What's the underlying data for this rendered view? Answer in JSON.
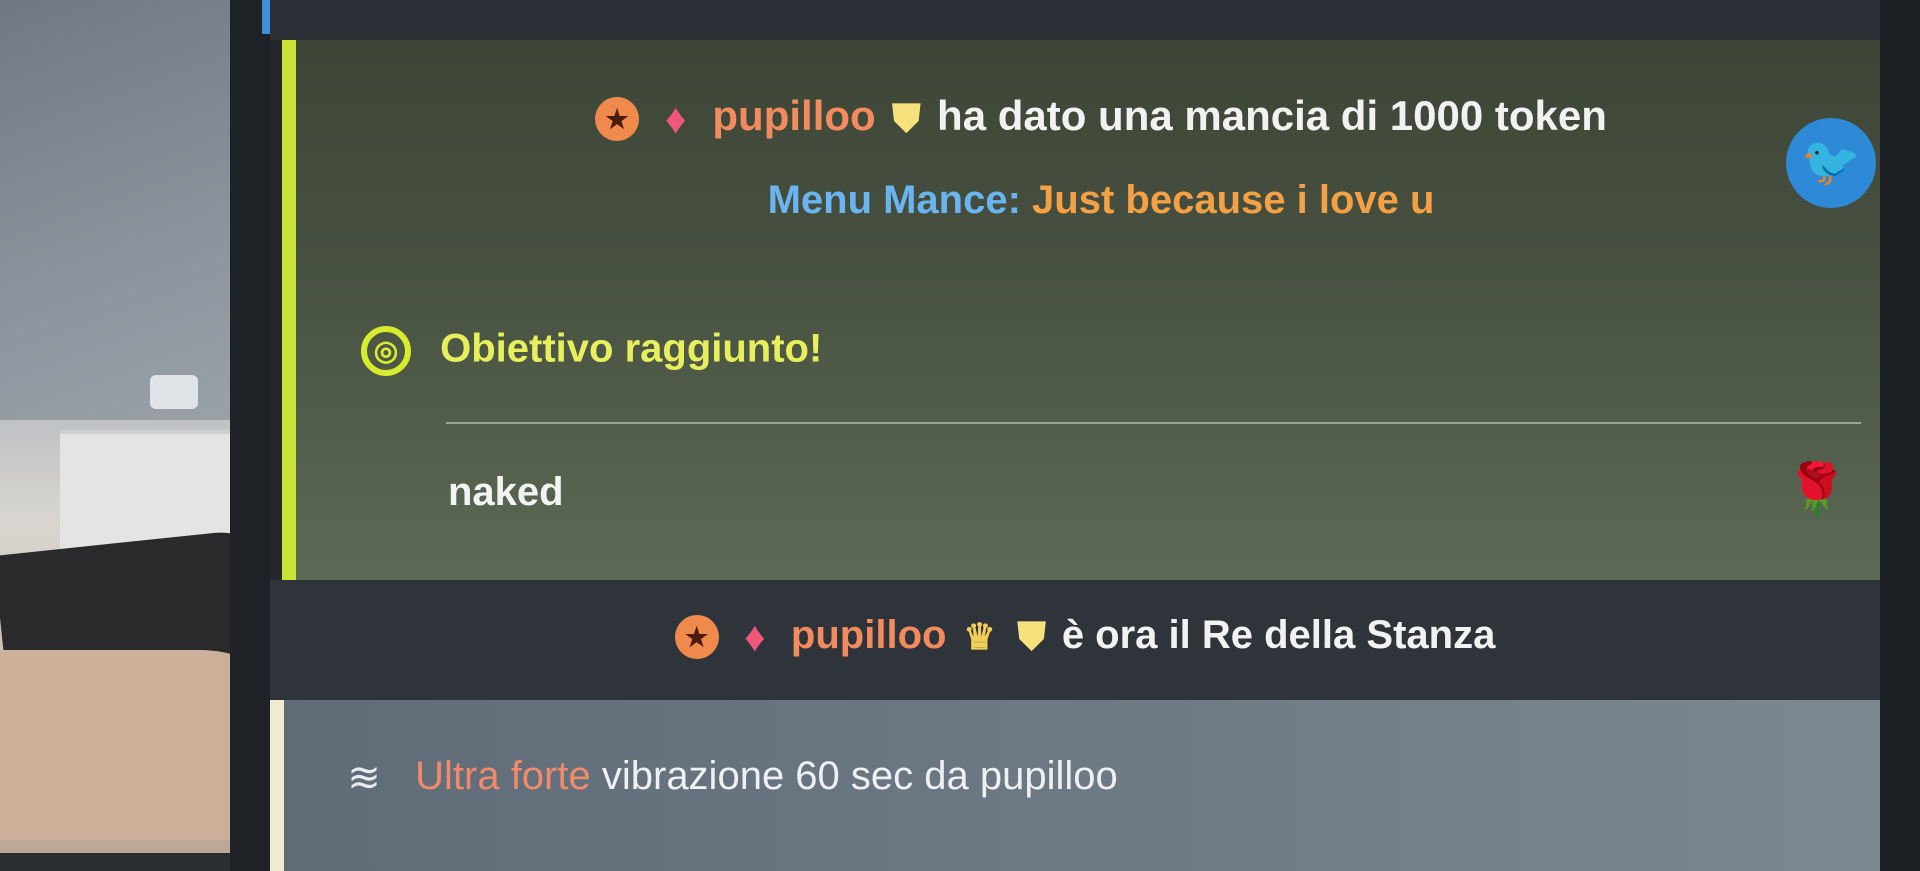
{
  "chat": {
    "tip": {
      "username": "pupilloo",
      "message": "ha dato una mancia di 1000 token",
      "menu_label": "Menu Mance:",
      "menu_item": "Just because i love u"
    },
    "goal": {
      "text": "Obiettivo raggiunto!",
      "item": "naked"
    },
    "king": {
      "username": "pupilloo",
      "message": "è ora il Re della Stanza"
    },
    "vibration": {
      "level": "Ultra forte",
      "message": "vibrazione 60 sec da pupilloo"
    }
  },
  "icons": {
    "star_badge": "★",
    "gem_badge": "♦",
    "shield_badge": "⛊",
    "crown_badge": "♛",
    "twitter": "🐦",
    "goal": "◎",
    "rose": "🌹",
    "vibration": "≋"
  },
  "colors": {
    "goal_accent": "#c9e339",
    "username": "#f28b5d",
    "menu_label": "#6ab4f0",
    "menu_item": "#f4a045",
    "twitter": "#2e8ad6"
  }
}
